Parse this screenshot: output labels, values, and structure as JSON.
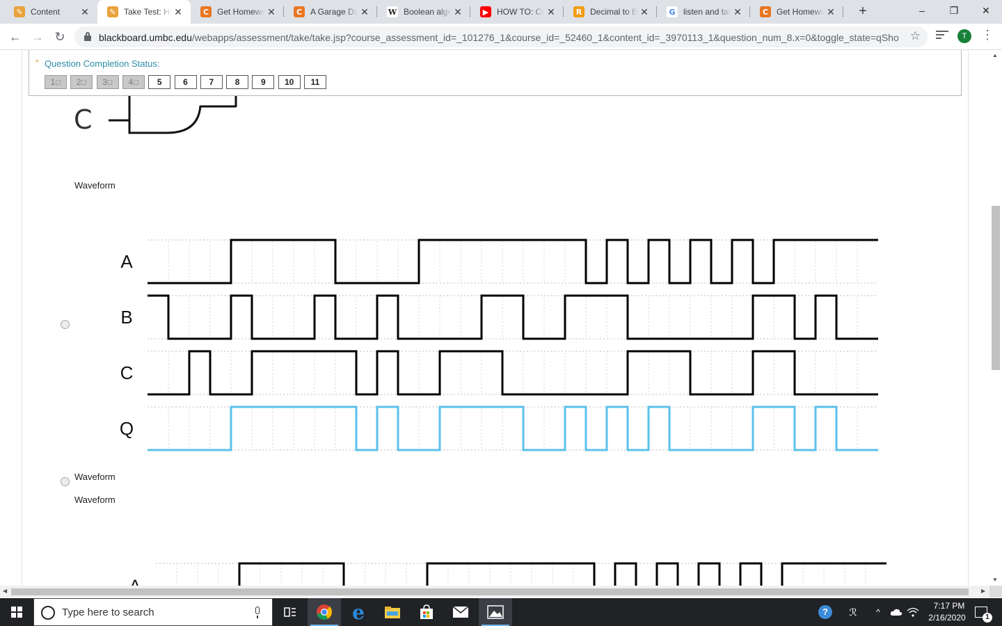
{
  "browser": {
    "tabs": [
      {
        "title": "Content",
        "favicon": "pencil-icon",
        "color": "#e8a33d",
        "active": false
      },
      {
        "title": "Take Test: Homework",
        "favicon": "pencil-icon",
        "color": "#e8a33d",
        "active": true
      },
      {
        "title": "Get Homework",
        "favicon": "chegg-icon",
        "color": "#e87722",
        "active": false
      },
      {
        "title": "A Garage Door",
        "favicon": "chegg-icon",
        "color": "#e87722",
        "active": false
      },
      {
        "title": "Boolean algebra",
        "favicon": "wikipedia-icon",
        "color": "#ffffff",
        "active": false
      },
      {
        "title": "HOW TO: Convert",
        "favicon": "youtube-icon",
        "color": "#ff0000",
        "active": false
      },
      {
        "title": "Decimal to Binary",
        "favicon": "rapidtables-icon",
        "color": "#f39c12",
        "active": false
      },
      {
        "title": "listen and talk",
        "favicon": "google-icon",
        "color": "#ffffff",
        "active": false
      },
      {
        "title": "Get Homework",
        "favicon": "chegg-icon",
        "color": "#e87722",
        "active": false
      }
    ],
    "new_tab_label": "+",
    "url_domain": "blackboard.umbc.edu",
    "url_path": "/webapps/assessment/take/take.jsp?course_assessment_id=_101276_1&course_id=_52460_1&content_id=_3970113_1&question_num_8.x=0&toggle_state=qShow...",
    "profile_initial": "T"
  },
  "question_status": {
    "title": "Question Completion Status:",
    "items": [
      {
        "label": "1",
        "done": true
      },
      {
        "label": "2",
        "done": true
      },
      {
        "label": "3",
        "done": true
      },
      {
        "label": "4",
        "done": true
      },
      {
        "label": "5",
        "done": false
      },
      {
        "label": "6",
        "done": false
      },
      {
        "label": "7",
        "done": false
      },
      {
        "label": "8",
        "done": false
      },
      {
        "label": "9",
        "done": false
      },
      {
        "label": "10",
        "done": false
      },
      {
        "label": "11",
        "done": false
      }
    ]
  },
  "circuit": {
    "input_label": "C"
  },
  "answers": {
    "waveform_label_1": "Waveform",
    "waveform_label_2": "Waveform",
    "waveform_label_3": "Waveform"
  },
  "waveforms": {
    "signals": [
      {
        "name": "A",
        "color": "#000000",
        "edges": [
          4,
          9,
          13,
          21,
          22,
          23,
          24,
          25,
          26,
          27,
          28,
          29,
          30
        ],
        "initial": 0
      },
      {
        "name": "B",
        "color": "#000000",
        "edges": [
          1,
          4,
          5,
          8,
          9,
          11,
          12,
          16,
          18,
          20,
          23,
          29,
          31,
          32,
          33
        ],
        "initial": 1
      },
      {
        "name": "C",
        "color": "#000000",
        "edges": [
          2,
          3,
          5,
          10,
          11,
          12,
          14,
          17,
          23,
          26,
          29,
          31
        ],
        "initial": 0
      },
      {
        "name": "Q",
        "color": "#5bc0eb",
        "edges": [
          4,
          10,
          11,
          12,
          14,
          18,
          20,
          21,
          22,
          23,
          24,
          25,
          29,
          31,
          32,
          33
        ],
        "initial": 0
      }
    ],
    "periods": 35,
    "second_view_first_label": "A"
  },
  "taskbar": {
    "search_placeholder": "Type here to search",
    "time": "7:17 PM",
    "date": "2/16/2020",
    "notification_count": "1"
  }
}
